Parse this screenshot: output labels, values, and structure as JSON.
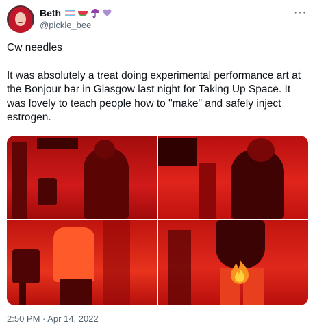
{
  "tweet": {
    "display_name": "Beth",
    "handle": "@pickle_bee",
    "name_emoji": [
      "transgender-flag-icon",
      "watermelon-icon",
      "umbrella-icon",
      "purple-heart-icon"
    ],
    "more_label": "···",
    "paragraphs": [
      "Cw needles",
      "It was absolutely a treat doing experimental performance art at the Bonjour bar in Glasgow last night for Taking Up Space. It was lovely to teach people how to \"make\" and safely inject estrogen."
    ],
    "timestamp": "2:50 PM · Apr 14, 2022"
  },
  "colors": {
    "text": "#0f1419",
    "secondary": "#536471",
    "photo_red": "#b50f0f"
  }
}
